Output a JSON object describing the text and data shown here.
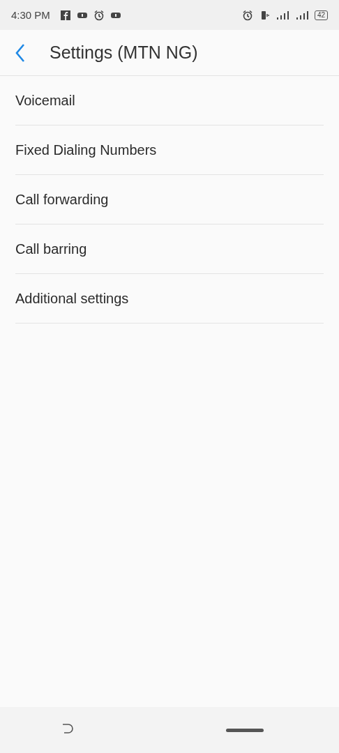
{
  "status_bar": {
    "time": "4:30 PM",
    "battery": "42"
  },
  "header": {
    "title": "Settings (MTN NG)"
  },
  "items": [
    {
      "label": "Voicemail"
    },
    {
      "label": "Fixed Dialing Numbers"
    },
    {
      "label": "Call forwarding"
    },
    {
      "label": "Call barring"
    },
    {
      "label": "Additional settings"
    }
  ]
}
